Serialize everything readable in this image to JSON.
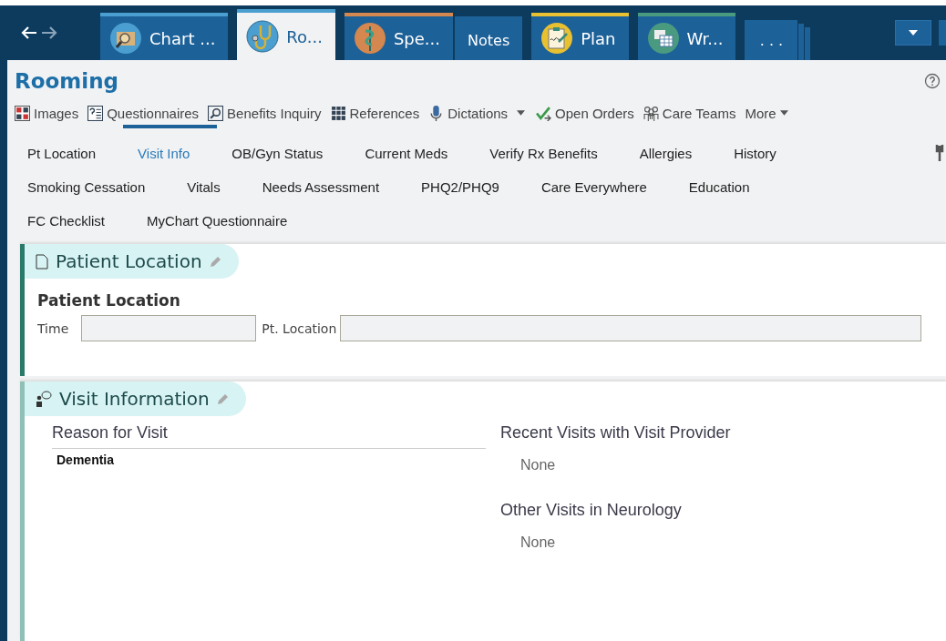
{
  "tabs": [
    {
      "label": "Chart ...",
      "kind": "folder",
      "selected": false,
      "color": "#4a9fd0"
    },
    {
      "label": "Ro...",
      "kind": "stethoscope",
      "selected": true,
      "color": "#4a9fd0"
    },
    {
      "label": "Spe...",
      "kind": "caduceus",
      "selected": false,
      "color": "#d4874e"
    },
    {
      "label": "Notes",
      "kind": "text",
      "selected": false
    },
    {
      "label": "Plan",
      "kind": "clipboard",
      "selected": false,
      "color": "#e8c030"
    },
    {
      "label": "Wr...",
      "kind": "calendar",
      "selected": false,
      "color": "#4a9a80"
    },
    {
      "label": ". . .",
      "kind": "overflow",
      "selected": false
    }
  ],
  "activity": {
    "title": "Rooming"
  },
  "toolbar": [
    {
      "label": "Images",
      "kind": "images",
      "has_menu": false
    },
    {
      "label": "Questionnaires",
      "kind": "questionnaire",
      "has_menu": false
    },
    {
      "label": "Benefits Inquiry",
      "kind": "search",
      "has_menu": false
    },
    {
      "label": "References",
      "kind": "books",
      "has_menu": false
    },
    {
      "label": "Dictations",
      "kind": "mic",
      "has_menu": true
    },
    {
      "label": "Open Orders",
      "kind": "check",
      "has_menu": false
    },
    {
      "label": "Care Teams",
      "kind": "people",
      "has_menu": false
    },
    {
      "label": "More",
      "kind": "none",
      "has_menu": true
    }
  ],
  "activity_tabs": [
    [
      {
        "label": "Pt Location",
        "selected": false
      },
      {
        "label": "Visit Info",
        "selected": true
      },
      {
        "label": "OB/Gyn Status",
        "selected": false
      },
      {
        "label": "Current Meds",
        "selected": false
      },
      {
        "label": "Verify Rx Benefits",
        "selected": false
      },
      {
        "label": "Allergies",
        "selected": false
      },
      {
        "label": "History",
        "selected": false
      }
    ],
    [
      {
        "label": "Smoking Cessation",
        "selected": false
      },
      {
        "label": "Vitals",
        "selected": false
      },
      {
        "label": "Needs Assessment",
        "selected": false
      },
      {
        "label": "PHQ2/PHQ9",
        "selected": false
      },
      {
        "label": "Care Everywhere",
        "selected": false
      },
      {
        "label": "Education",
        "selected": false
      }
    ],
    [
      {
        "label": "FC Checklist",
        "selected": false
      },
      {
        "label": "MyChart Questionnaire",
        "selected": false
      }
    ]
  ],
  "patient_location": {
    "title": "Patient Location",
    "subtitle": "Patient Location",
    "time_label": "Time",
    "location_label": "Pt. Location"
  },
  "visit_information": {
    "title": "Visit Information",
    "reason_heading": "Reason for Visit",
    "reasons": [
      "Dementia"
    ],
    "recent_heading": "Recent Visits with Visit Provider",
    "recent_value": "None",
    "other_heading": "Other Visits in Neurology",
    "other_value": "None"
  }
}
